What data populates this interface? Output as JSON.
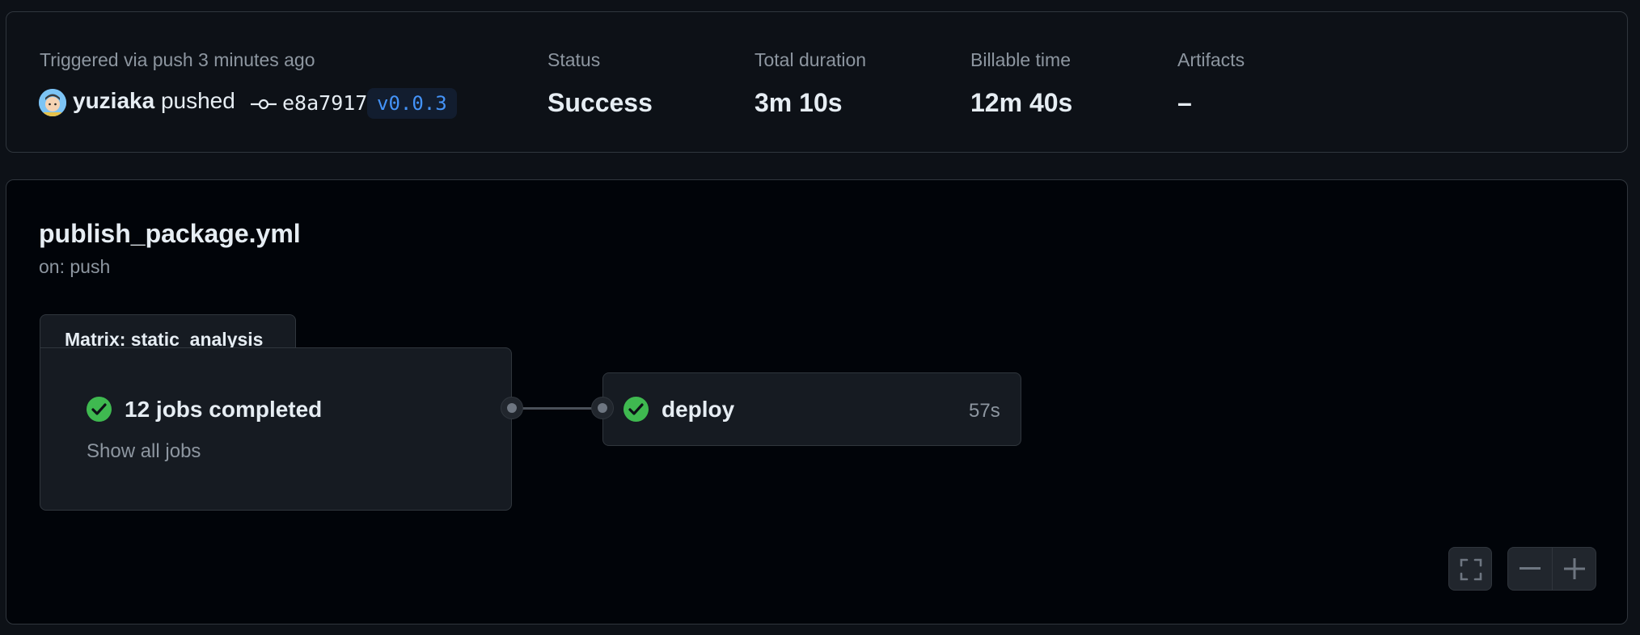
{
  "summary": {
    "trigger_text": "Triggered via push 3 minutes ago",
    "actor": "yuziaka",
    "action": "pushed",
    "commit_sha": "e8a7917",
    "tag": "v0.0.3",
    "status_label": "Status",
    "status_value": "Success",
    "duration_label": "Total duration",
    "duration_value": "3m 10s",
    "billable_label": "Billable time",
    "billable_value": "12m 40s",
    "artifacts_label": "Artifacts",
    "artifacts_value": "–"
  },
  "workflow": {
    "file": "publish_package.yml",
    "trigger": "on: push",
    "matrix": {
      "label": "Matrix: static_analysis",
      "jobs_text": "12 jobs completed",
      "show_all": "Show all jobs",
      "status": "success"
    },
    "deploy": {
      "label": "deploy",
      "duration": "57s",
      "status": "success"
    }
  },
  "controls": {
    "fullscreen_icon": "fullscreen-icon",
    "zoom_out_icon": "minus-icon",
    "zoom_in_icon": "plus-icon"
  },
  "colors": {
    "success": "#3fb950",
    "tag_text": "#4493f8"
  }
}
